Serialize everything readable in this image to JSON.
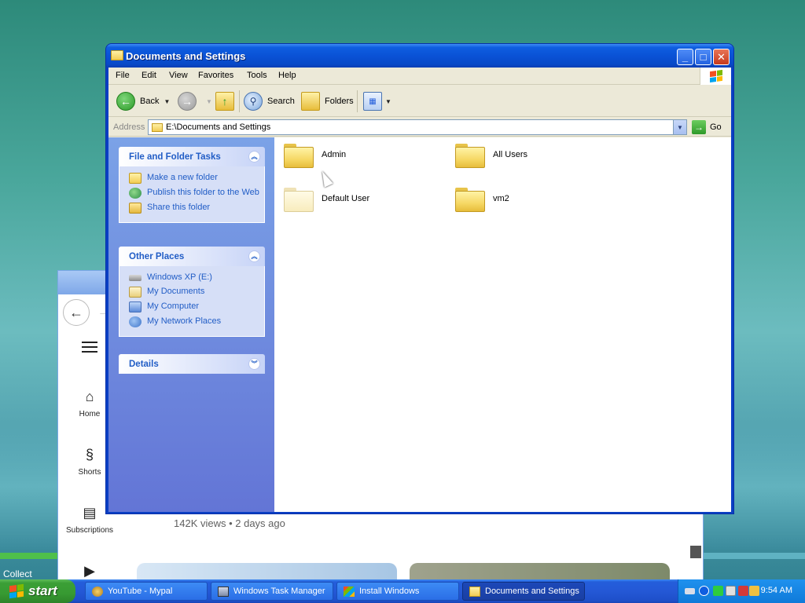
{
  "explorer": {
    "title": "Documents and Settings",
    "menu": [
      "File",
      "Edit",
      "View",
      "Favorites",
      "Tools",
      "Help"
    ],
    "toolbar": {
      "back_label": "Back",
      "search_label": "Search",
      "folders_label": "Folders"
    },
    "address": {
      "label": "Address",
      "value": "E:\\Documents and Settings",
      "go_label": "Go"
    },
    "taskpane": {
      "file_tasks": {
        "title": "File and Folder Tasks",
        "links": [
          "Make a new folder",
          "Publish this folder to the Web",
          "Share this folder"
        ]
      },
      "other_places": {
        "title": "Other Places",
        "links": [
          "Windows XP (E:)",
          "My Documents",
          "My Computer",
          "My Network Places"
        ]
      },
      "details": {
        "title": "Details"
      }
    },
    "files": [
      "Admin",
      "All Users",
      "Default User",
      "vm2"
    ]
  },
  "browser": {
    "sidebar": [
      "Home",
      "Shorts",
      "Subscriptions"
    ],
    "views_text": "142K views • 2 days ago"
  },
  "desktop": {
    "partial_label": "Collect"
  },
  "taskbar": {
    "start_label": "start",
    "tasks": [
      "YouTube - Mypal",
      "Windows Task Manager",
      "Install Windows",
      "Documents and Settings"
    ],
    "active_task": "Documents and Settings",
    "clock": "9:54 AM"
  },
  "colors": {
    "title_blue": "#0a52d6",
    "taskpane_link": "#215dc6",
    "start_green": "#379a32"
  }
}
